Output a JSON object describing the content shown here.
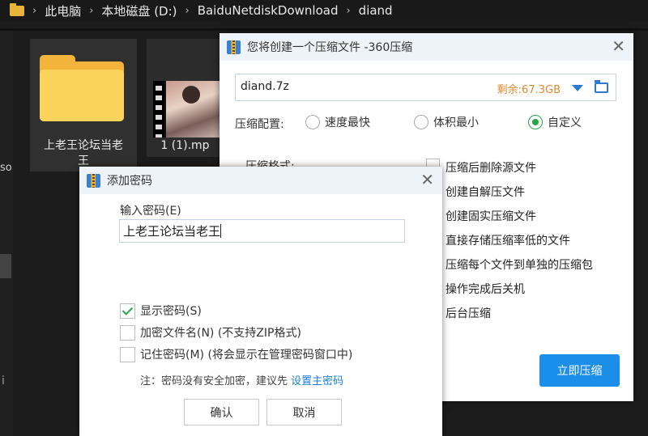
{
  "explorer": {
    "breadcrumb": [
      "此电脑",
      "本地磁盘 (D:)",
      "BaiduNetdiskDownload",
      "diand"
    ],
    "sidebar_stub": "so",
    "folder_tile": {
      "label_line1": "上老王论坛当老",
      "label_line2": "王"
    },
    "video_tile": {
      "label": "1 (1).mp"
    }
  },
  "compress_dialog": {
    "title": "您将创建一个压缩文件 -360压缩",
    "filename": "diand.7z",
    "free_space": "剩余:67.3GB",
    "config_label": "压缩配置:",
    "radio_options": [
      {
        "label": "速度最快",
        "selected": false
      },
      {
        "label": "体积最小",
        "selected": false
      },
      {
        "label": "自定义",
        "selected": true
      }
    ],
    "format_label": "压缩格式:",
    "options": [
      "压缩后删除源文件",
      "创建自解压文件",
      "创建固实压缩文件",
      "直接存储压缩率低的文件",
      "压缩每个文件到单独的压缩包",
      "操作完成后关机",
      "后台压缩"
    ],
    "compress_button": "立即压缩"
  },
  "password_dialog": {
    "title": "添加密码",
    "input_label": "输入密码(E)",
    "password_value": "上老王论坛当老王",
    "checkboxes": [
      {
        "label": "显示密码(S)",
        "checked": true
      },
      {
        "label": "加密文件名(N) (不支持ZIP格式)",
        "checked": false
      },
      {
        "label": "记住密码(M) (将会显示在管理密码窗口中)",
        "checked": false
      }
    ],
    "note_text": "注：密码没有安全加密，建议先",
    "note_link": "设置主密码",
    "ok_button": "确认",
    "cancel_button": "取消"
  },
  "colors": {
    "accent": "#1a8ee8",
    "check_green": "#28a745",
    "free_space": "#e0892e",
    "folder": "#f2b43b"
  }
}
